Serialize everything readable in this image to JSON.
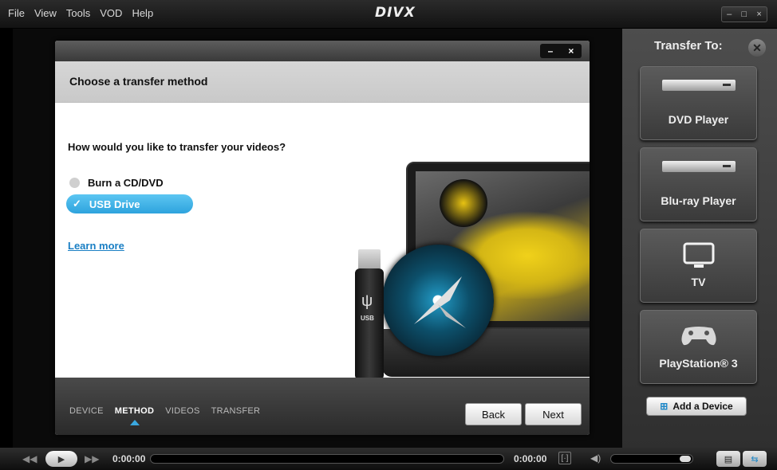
{
  "menu": {
    "items": [
      "File",
      "View",
      "Tools",
      "VOD",
      "Help"
    ]
  },
  "app": {
    "logo": "DIVX"
  },
  "window_controls": {
    "minimize": "–",
    "maximize": "□",
    "close": "×"
  },
  "dialog": {
    "controls": {
      "minimize": "–",
      "close": "×"
    },
    "title": "Choose a transfer method",
    "question": "How would you like to transfer your videos?",
    "options": [
      {
        "label": "Burn a CD/DVD",
        "selected": false
      },
      {
        "label": "USB Drive",
        "selected": true
      }
    ],
    "learn_more": "Learn more",
    "usb_label": "USB",
    "steps": [
      {
        "label": "DEVICE",
        "active": false
      },
      {
        "label": "METHOD",
        "active": true
      },
      {
        "label": "VIDEOS",
        "active": false
      },
      {
        "label": "TRANSFER",
        "active": false
      }
    ],
    "back_label": "Back",
    "next_label": "Next"
  },
  "panel": {
    "title": "Transfer To:",
    "devices": [
      {
        "label": "DVD Player",
        "icon": "dvd-player-icon"
      },
      {
        "label": "Blu-ray Player",
        "icon": "bluray-player-icon"
      },
      {
        "label": "TV",
        "icon": "tv-icon"
      },
      {
        "label": "PlayStation® 3",
        "icon": "gamepad-icon"
      }
    ],
    "add_device": "Add a Device"
  },
  "transport": {
    "elapsed": "0:00:00",
    "duration": "0:00:00",
    "progress": 0,
    "volume": 1.0
  },
  "colors": {
    "accent": "#2ea3dd",
    "link": "#1a7fc4"
  }
}
